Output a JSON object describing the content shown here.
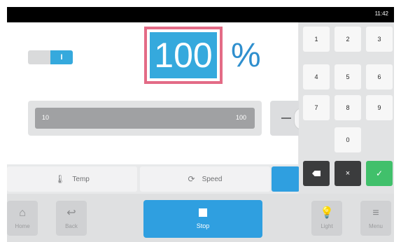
{
  "status": {
    "time": "11:42"
  },
  "main": {
    "toggle_label": "I",
    "value": "100",
    "unit": "%",
    "range": {
      "min": "10",
      "max": "100"
    },
    "minus_label": "—"
  },
  "tabs": [
    {
      "label": "Temp",
      "icon": "thermometer-icon",
      "glyph": "🌡"
    },
    {
      "label": "Speed",
      "icon": "refresh-icon",
      "glyph": "⟳"
    }
  ],
  "keypad": {
    "keys": [
      "1",
      "2",
      "3",
      "4",
      "5",
      "6",
      "7",
      "8",
      "9",
      "0"
    ],
    "clear_label": "×",
    "ok_label": "✓"
  },
  "bottom": {
    "home": {
      "label": "Home",
      "glyph": "⌂"
    },
    "back": {
      "label": "Back",
      "glyph": "↩"
    },
    "stop": {
      "label": "Stop"
    },
    "light": {
      "label": "Light",
      "glyph": "💡"
    },
    "menu": {
      "label": "Menu",
      "glyph": "≡"
    }
  },
  "colors": {
    "accent": "#2f9fe0",
    "highlight_border": "#e36b86",
    "ok": "#41c06b",
    "dark": "#3b3c3d"
  }
}
